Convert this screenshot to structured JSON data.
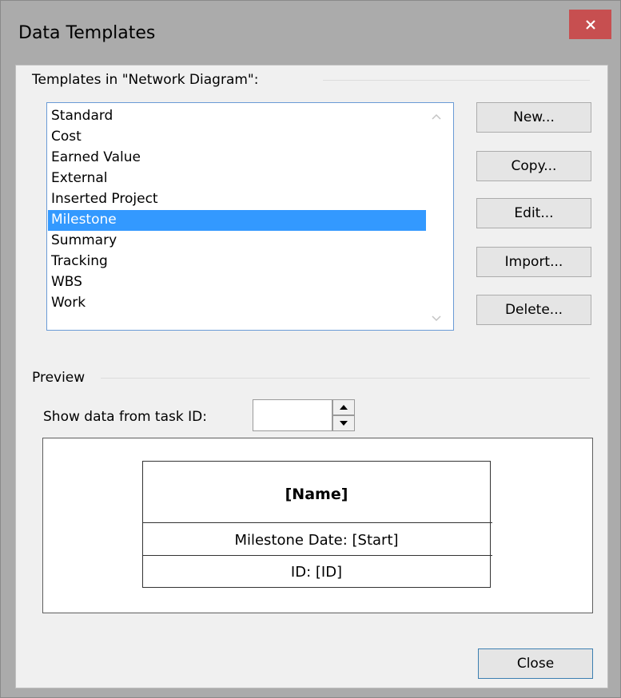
{
  "window": {
    "title": "Data Templates"
  },
  "templates": {
    "group_label": "Templates in \"Network Diagram\":",
    "items": [
      "Standard",
      "Cost",
      "Earned Value",
      "External",
      "Inserted Project",
      "Milestone",
      "Summary",
      "Tracking",
      "WBS",
      "Work"
    ],
    "selected": "Milestone"
  },
  "buttons": {
    "new": "New...",
    "copy": "Copy...",
    "edit": "Edit...",
    "import": "Import...",
    "delete": "Delete...",
    "close": "Close"
  },
  "preview": {
    "group_label": "Preview",
    "task_id_label": "Show data from task ID:",
    "task_id_value": "",
    "node": {
      "name": "[Name]",
      "date": "Milestone Date: [Start]",
      "id": "ID: [ID]"
    }
  },
  "colors": {
    "selection": "#3399ff",
    "close_button": "#c74f50",
    "list_border": "#6a9bd6"
  },
  "icons": {
    "close": "close-icon",
    "scroll_up": "scroll-up-icon",
    "scroll_down": "scroll-down-icon",
    "spin_up": "spin-up-icon",
    "spin_down": "spin-down-icon"
  }
}
